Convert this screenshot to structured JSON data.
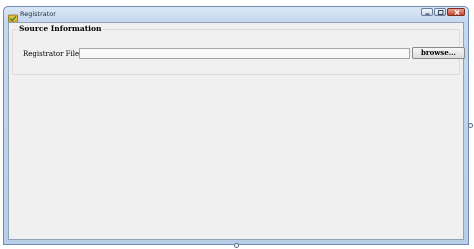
{
  "window": {
    "title": "Registrator",
    "app_icon": "registrator-app-icon",
    "caption_buttons": [
      "minimize-icon",
      "maximize-icon",
      "close-icon"
    ]
  },
  "source_information": {
    "legend": "Source Information",
    "file_label": "Registrator File:",
    "file_value": "",
    "browse_label": "browse..."
  },
  "colors": {
    "titlebar": "#c6d8ee",
    "client_background": "#f0f0f0",
    "close_button": "#c8432d"
  }
}
